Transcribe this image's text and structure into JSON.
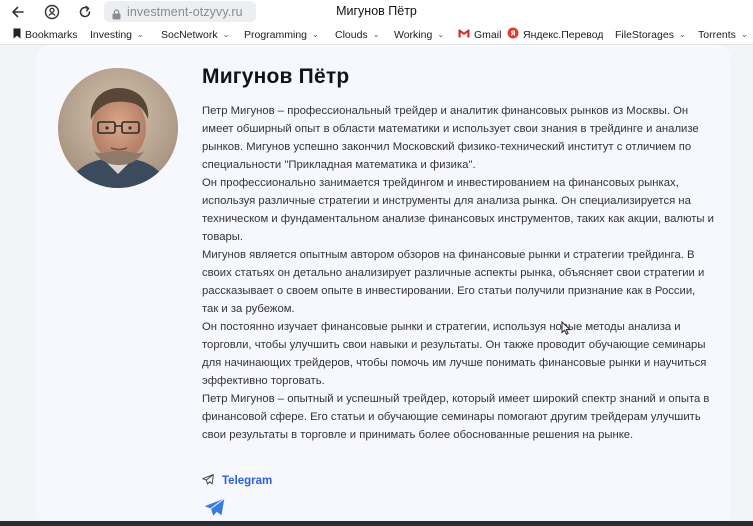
{
  "toolbar": {
    "back_icon": "back-arrow-icon",
    "profile_icon": "profile-icon",
    "reload_icon": "reload-icon",
    "url": "investment-otzyvy.ru",
    "window_title": "Мигунов Пётр"
  },
  "bookmarks": [
    {
      "label": "Bookmarks",
      "icon": "bookmark-icon",
      "dropdown": false
    },
    {
      "label": "Investing",
      "dropdown": true
    },
    {
      "label": "SocNetwork",
      "dropdown": true
    },
    {
      "label": "Programming",
      "dropdown": true
    },
    {
      "label": "Clouds",
      "dropdown": true
    },
    {
      "label": "Working",
      "dropdown": true
    },
    {
      "label": "Gmail",
      "icon": "gmail-icon",
      "dropdown": false
    },
    {
      "label": "Яндекс.Переводч",
      "icon": "yandex-translate-icon",
      "dropdown": false
    },
    {
      "label": "FileStorages",
      "dropdown": true
    },
    {
      "label": "Torrents",
      "dropdown": true
    }
  ],
  "author": {
    "name": "Мигунов Пётр",
    "bio_paragraphs": [
      "Петр Мигунов – профессиональный трейдер и аналитик финансовых рынков из Москвы. Он имеет обширный опыт в области математики и использует свои знания в трейдинге и анализе рынков. Мигунов успешно закончил Московский физико-технический институт с отличием по специальности \"Прикладная математика и физика\".",
      "Он профессионально занимается трейдингом и инвестированием на финансовых рынках, используя различные стратегии и инструменты для анализа рынка. Он специализируется на техническом и фундаментальном анализе финансовых инструментов, таких как акции, валюты и товары.",
      "Мигунов является опытным автором обзоров на финансовые рынки и стратегии трейдинга. В своих статьях он детально анализирует различные аспекты рынка, объясняет свои стратегии и рассказывает о своем опыте в инвестировании. Его статьи получили признание как в России, так и за рубежом.",
      "Он постоянно изучает финансовые рынки и стратегии, используя новые методы анализа и торговли, чтобы улучшить свои навыки и результаты. Он также проводит обучающие семинары для начинающих трейдеров, чтобы помочь им лучше понимать финансовые рынки и научиться эффективно торговать.",
      "Петр Мигунов – опытный и успешный трейдер, который имеет широкий спектр знаний и опыта в финансовой сфере. Его статьи и обучающие семинары помогают другим трейдерам улучшить свои результаты в торговле и принимать более обоснованные решения на рынке."
    ],
    "telegram_label": "Telegram",
    "telegram_icon": "telegram-icon"
  },
  "colors": {
    "link": "#2d5fd6",
    "card_bg": "#f7f8fd",
    "text": "#333338"
  }
}
